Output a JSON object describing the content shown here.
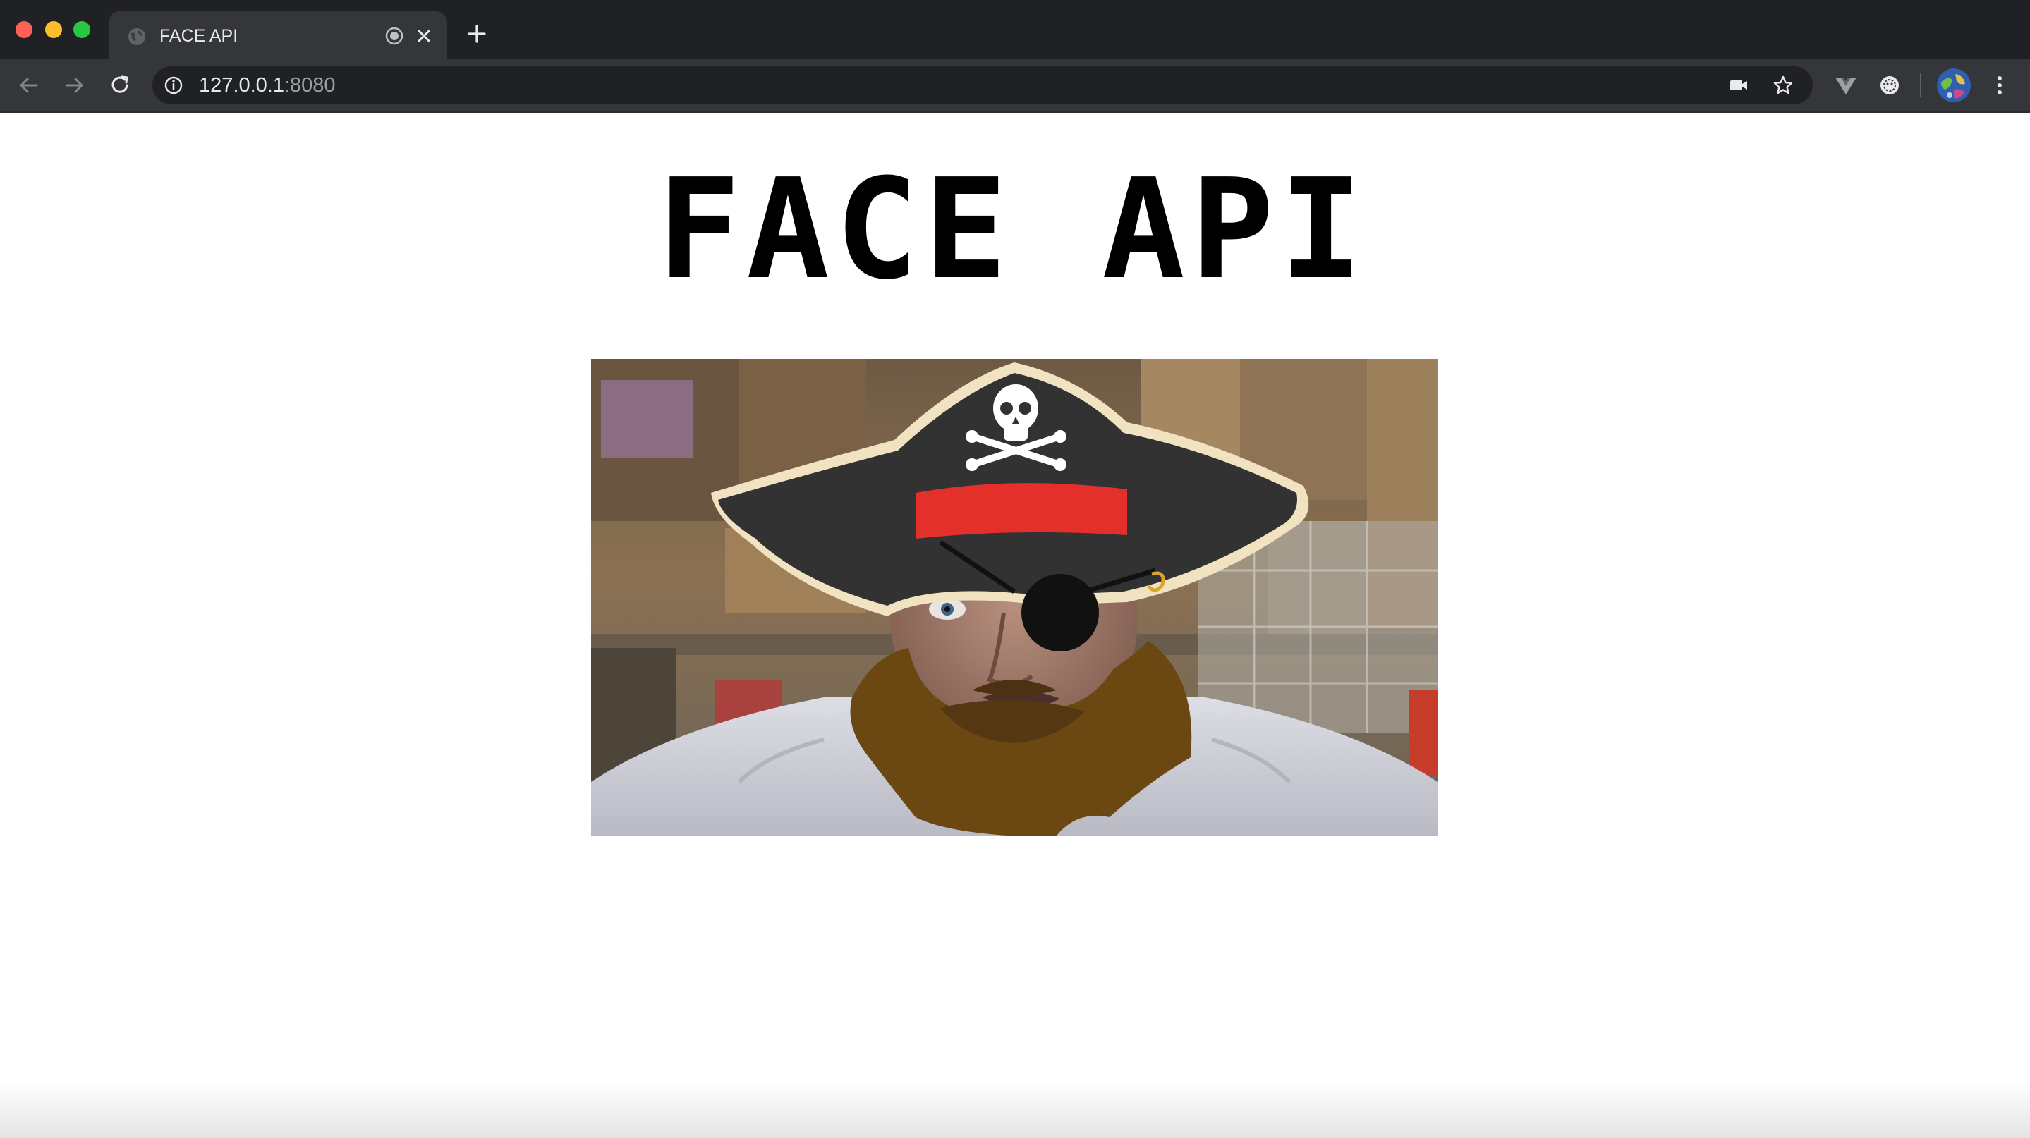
{
  "browser": {
    "tab": {
      "title": "FACE API"
    },
    "address_bar": {
      "host": "127.0.0.1",
      "port": ":8080"
    },
    "icons": {
      "tab_favicon": "globe-icon",
      "tab_audio": "recording-icon",
      "tab_close": "close-icon",
      "new_tab": "plus-icon",
      "back": "arrow-left-icon",
      "forward": "arrow-right-icon",
      "reload": "reload-icon",
      "site_info": "info-icon",
      "camera": "video-camera-icon",
      "bookmark": "star-icon",
      "extension_vue": "vue-devtools-icon",
      "extension_other": "extension-icon",
      "profile": "profile-avatar",
      "menu": "kebab-menu-icon"
    },
    "colors": {
      "tabstrip": "#202124",
      "toolbar": "#35363a",
      "traffic_red": "#fe5f57",
      "traffic_yellow": "#febc2e",
      "traffic_green": "#28c840"
    }
  },
  "page": {
    "title": "FACE API",
    "camera_feed": {
      "description_icon": "webcam-video",
      "overlays": [
        "pirate-hat",
        "eye-patch",
        "beard"
      ]
    },
    "colors": {
      "background": "#ffffff",
      "title": "#000000",
      "hat": "#323232",
      "hat_band": "#e3302a",
      "hat_trim": "#f1e2c2",
      "beard": "#6b4712"
    }
  }
}
